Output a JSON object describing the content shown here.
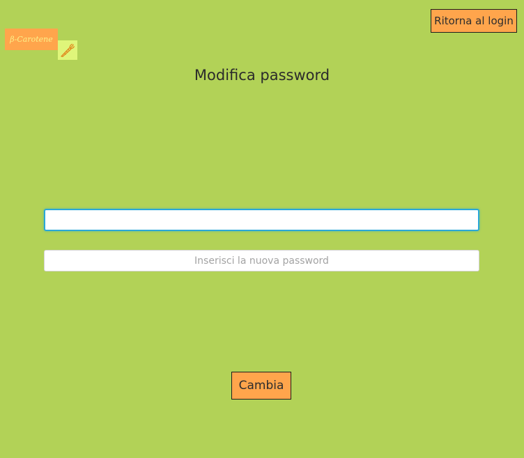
{
  "header": {
    "back_to_login_label": "Ritorna al login"
  },
  "logo": {
    "text": "β-Carotene",
    "icon": "carrot-icon"
  },
  "page": {
    "title": "Modifica password"
  },
  "form": {
    "current_field_value": "",
    "current_field_placeholder": "",
    "new_password_value": "",
    "new_password_placeholder": "Inserisci la nuova password",
    "submit_label": "Cambia"
  },
  "colors": {
    "background": "#b2d257",
    "button": "#ffa54c",
    "logo_text": "#fbf28a",
    "logo_icon_bg": "#dff57a",
    "focus_ring": "#2aa7d8"
  }
}
